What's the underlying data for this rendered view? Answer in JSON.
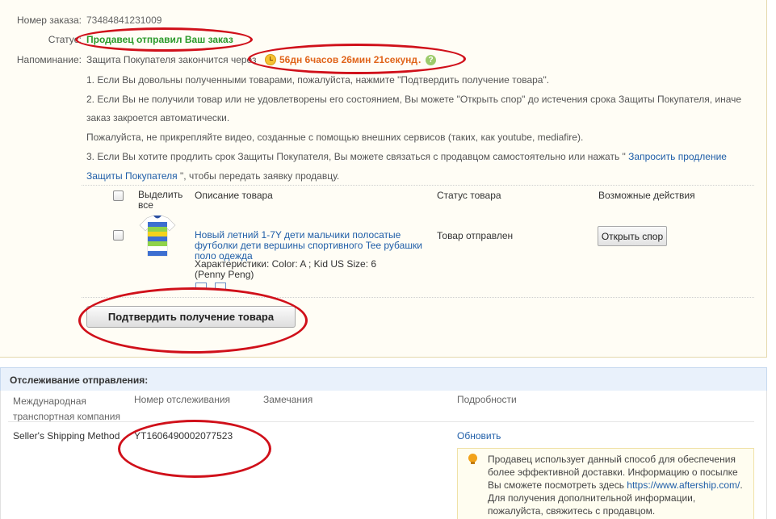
{
  "order": {
    "number_label": "Номер заказа:",
    "number_value": "73484841231009",
    "status_label": "Статус:",
    "status_value": "Продавец отправил Ваш заказ",
    "reminder_label": "Напоминание:",
    "reminder_text": "Защита Покупателя закончится через",
    "timer": "56дн 6часов 26мин 21секунд",
    "timer_suffix": ".",
    "help_glyph": "?",
    "notes": {
      "n1": "1. Если Вы довольны полученными товарами, пожалуйста, нажмите \"Подтвердить получение товара\".",
      "n2a": "2. Если Вы не получили товар или не удовлетворены его состоянием, Вы можете \"Открыть спор\" до истечения срока Защиты Покупателя, иначе",
      "n2b": "заказ закроется автоматически.",
      "n_video": "Пожалуйста, не прикрепляйте видео, созданные с помощью внешних сервисов (таких, как youtube, mediafire).",
      "n3a": "3. Если Вы хотите продлить срок Защиты Покупателя, Вы можете связаться с продавцом самостоятельно или нажать \"",
      "n3_link_a": "Запросить продление",
      "n3_link_b": "Защиты Покупателя",
      "n3b": "\", чтобы передать заявку продавцу."
    }
  },
  "product_table": {
    "select_all_a": "Выделить",
    "select_all_b": "все",
    "col_description": "Описание товара",
    "col_status": "Статус товара",
    "col_actions": "Возможные действия",
    "item": {
      "title": "Новый летний 1-7Y дети мальчики полосатые футболки дети вершины спортивного Tee рубашки поло одежда",
      "specs": "Характеристики: Color: A ; Kid US Size: 6",
      "seller": "(Penny Peng)",
      "status": "Товар отправлен",
      "action_button": "Открыть спор"
    },
    "confirm_button": "Подтвердить получение товара"
  },
  "tracking": {
    "title": "Отслеживание отправления:",
    "col_company_a": "Международная",
    "col_company_b": "транспортная компания",
    "col_number": "Номер отслеживания",
    "col_notes": "Замечания",
    "col_details": "Подробности",
    "row": {
      "company": "Seller's Shipping Method",
      "number": "YT1606490002077523",
      "refresh": "Обновить"
    },
    "info": {
      "l1": "Продавец использует данный способ для обеспечения",
      "l2": "более эффективной доставки. Информацию о посылке",
      "l3a": "Вы сможете посмотреть здесь ",
      "l3_link": "https://www.aftership.com/",
      "l3b": ".",
      "l4": "Для получения дополнительной информации,",
      "l5": "пожалуйста, свяжитесь с продавцом."
    }
  },
  "colors": {
    "status_green": "#2a9a2a",
    "timer_orange": "#e0641a",
    "link_blue": "#1f5ea8",
    "annotation_red": "#d0101a"
  }
}
